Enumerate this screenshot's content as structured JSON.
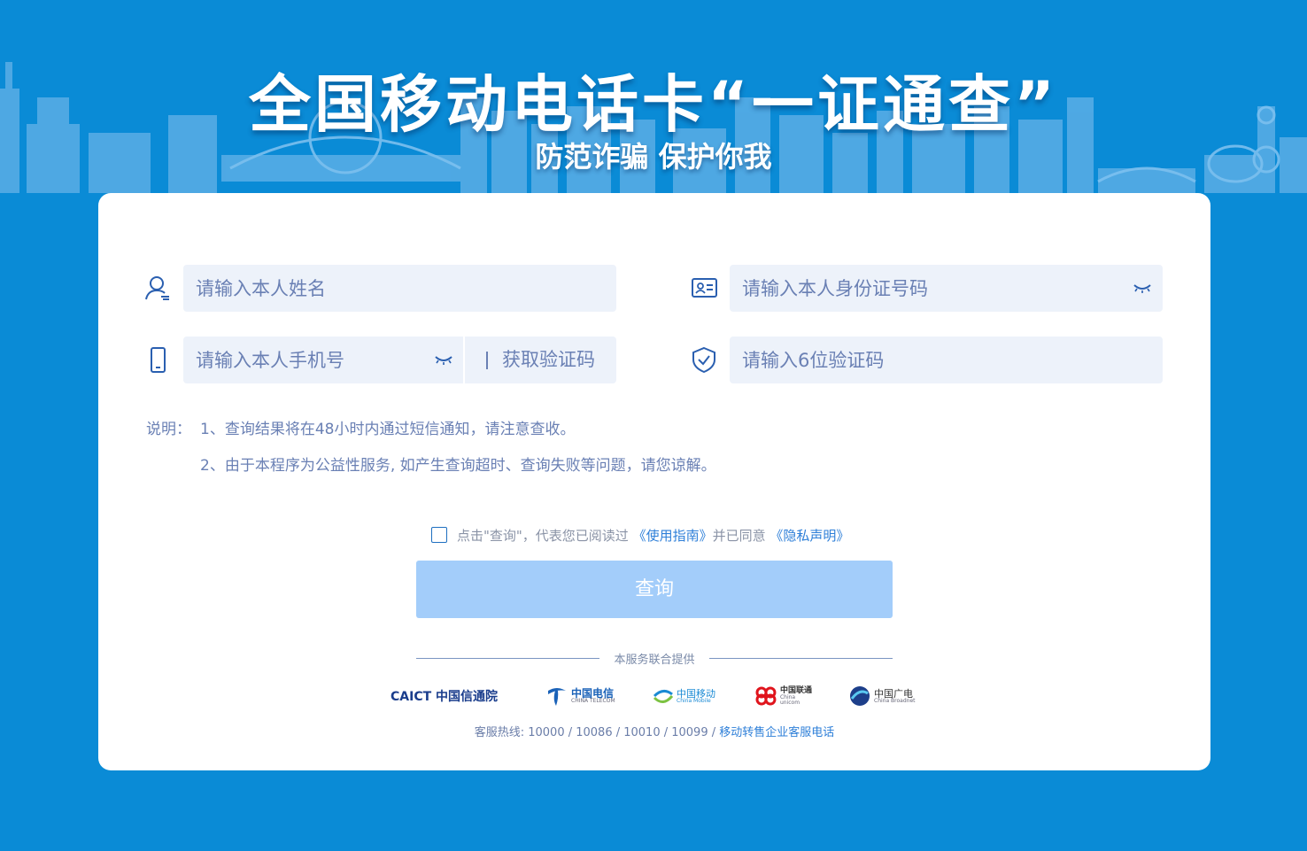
{
  "banner": {
    "title": "全国移动电话卡“一证通查”",
    "subtitle": "防范诈骗 保护你我"
  },
  "form": {
    "name_placeholder": "请输入本人姓名",
    "id_placeholder": "请输入本人身份证号码",
    "phone_placeholder": "请输入本人手机号",
    "get_code_label": "获取验证码",
    "code_placeholder": "请输入6位验证码"
  },
  "notes": {
    "label": "说明：",
    "items": [
      "1、查询结果将在48小时内通过短信通知，请注意查收。",
      "2、由于本程序为公益性服务, 如产生查询超时、查询失败等问题，请您谅解。"
    ]
  },
  "agreement": {
    "prefix": "点击\"查询\"，代表您已阅读过",
    "guide_link": "《使用指南》",
    "middle": "并已同意",
    "privacy_link": "《隐私声明》",
    "checked": false
  },
  "query_button": "查询",
  "providers": {
    "title": "本服务联合提供",
    "logos": [
      {
        "name": "CAICT 中国信通院",
        "icon": "caict-logo",
        "color": "#1a3d8c"
      },
      {
        "name": "中国电信",
        "sub": "CHINA TELECOM",
        "icon": "china-telecom-logo",
        "color": "#1a62b8"
      },
      {
        "name": "中国移动",
        "sub": "China Mobile",
        "icon": "china-mobile-logo",
        "color": "#1a8ad4"
      },
      {
        "name": "中国联通",
        "sub": "China unicom",
        "icon": "china-unicom-logo",
        "color": "#e0141c"
      },
      {
        "name": "中国广电",
        "sub": "China Broadnet",
        "icon": "china-broadnet-logo",
        "color": "#1d3f8a"
      }
    ]
  },
  "hotline": {
    "label": "客服热线: 10000 / 10086 / 10010 / 10099 /",
    "link": "移动转售企业客服电话"
  },
  "colors": {
    "background": "#0a8bd6",
    "field_bg": "#edf2fa",
    "placeholder": "#6a80b4",
    "button": "#a3cdfa",
    "link": "#2e7fd8"
  }
}
